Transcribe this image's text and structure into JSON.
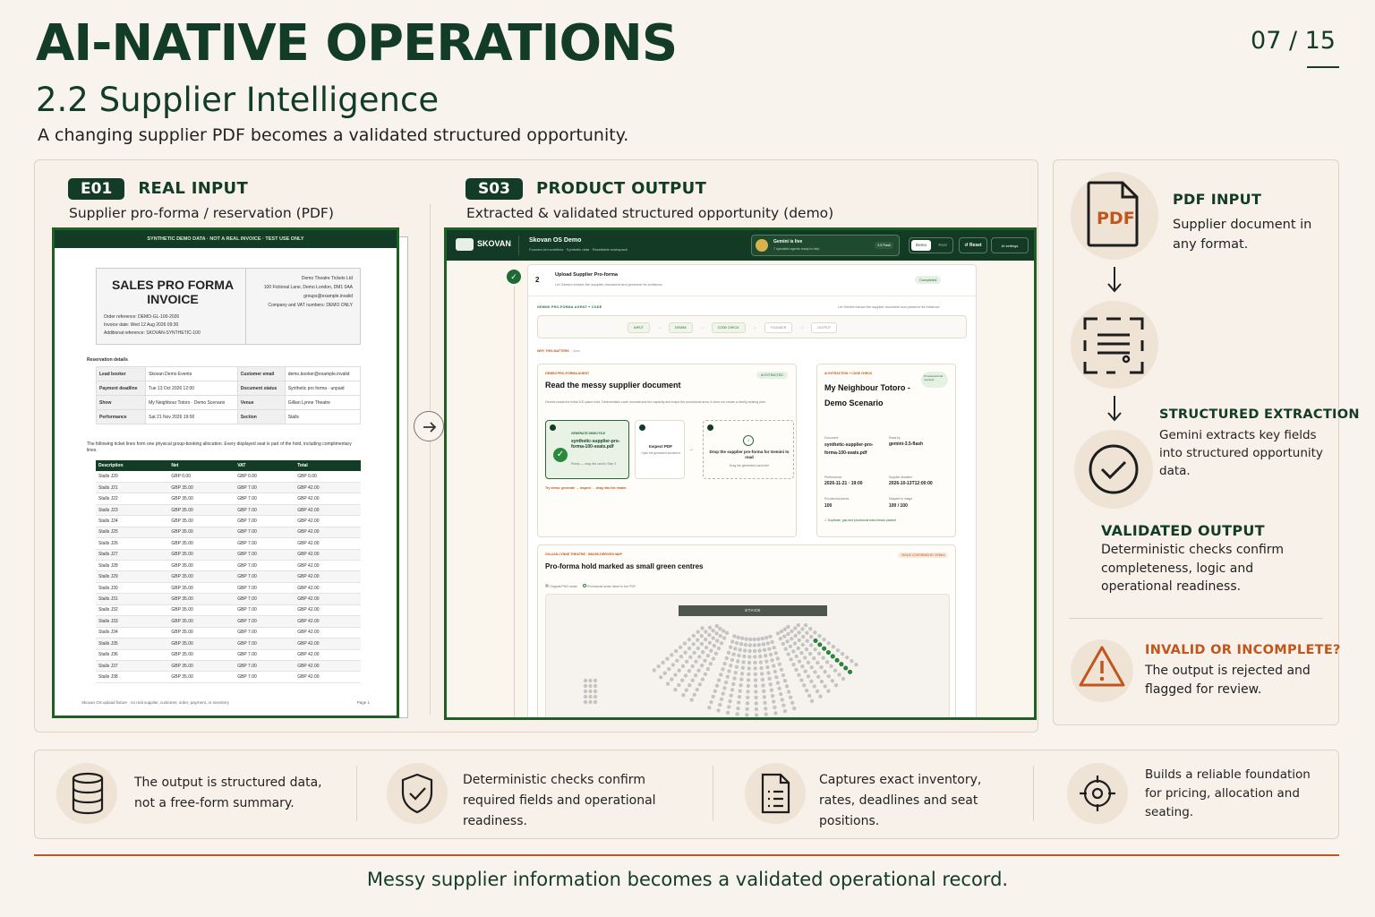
{
  "header": {
    "title": "AI-NATIVE OPERATIONS",
    "page": "07 / 15",
    "subtitle": "2.2 Supplier Intelligence",
    "tagline": "A changing supplier PDF becomes a validated structured opportunity."
  },
  "input": {
    "tag": "E01",
    "title": "REAL INPUT",
    "subtitle": "Supplier pro-forma / reservation (PDF)"
  },
  "output": {
    "tag": "S03",
    "title": "PRODUCT OUTPUT",
    "subtitle": "Extracted & validated structured opportunity (demo)"
  },
  "invoice": {
    "banner": "SYNTHETIC DEMO DATA · NOT A REAL INVOICE · TEST USE ONLY",
    "heading": "SALES PRO FORMA INVOICE",
    "order_ref": "Order reference: DEMO-GL-100-2026",
    "invoice_date": "Invoice date: Wed 12 Aug 2026 09:30",
    "additional_ref": "Additional reference: SKOVAN-SYNTHETIC-100",
    "company": "Demo Theatre Tickets Ltd",
    "address": "100 Fictional Lane, Demo London, DM1 0AA",
    "email": "groups@example.invalid",
    "vat": "Company and VAT numbers: DEMO ONLY",
    "reservation_label": "Reservation details",
    "reservation": [
      [
        "Lead booker",
        "Skovan Demo Events",
        "Customer email",
        "demo.booker@example.invalid"
      ],
      [
        "Payment deadline",
        "Tue 13 Oct 2026 12:00",
        "Document status",
        "Synthetic pro forma · unpaid"
      ],
      [
        "Show",
        "My Neighbour Totoro · Demo Scenario",
        "Venue",
        "Gillian Lynne Theatre"
      ],
      [
        "Performance",
        "Sat 21 Nov 2026 19:00",
        "Section",
        "Stalls"
      ]
    ],
    "note": "The following ticket lines form one physical group-booking allocation. Every displayed seat is part of the hold, including complimentary lines.",
    "columns": [
      "Description",
      "Net",
      "VAT",
      "Total"
    ],
    "lines": [
      [
        "Stalls J20",
        "GBP 0.00",
        "GBP 0.00",
        "GBP 0.00"
      ],
      [
        "Stalls J21",
        "GBP 35.00",
        "GBP 7.00",
        "GBP 42.00"
      ],
      [
        "Stalls J22",
        "GBP 35.00",
        "GBP 7.00",
        "GBP 42.00"
      ],
      [
        "Stalls J23",
        "GBP 35.00",
        "GBP 7.00",
        "GBP 42.00"
      ],
      [
        "Stalls J24",
        "GBP 35.00",
        "GBP 7.00",
        "GBP 42.00"
      ],
      [
        "Stalls J25",
        "GBP 35.00",
        "GBP 7.00",
        "GBP 42.00"
      ],
      [
        "Stalls J26",
        "GBP 35.00",
        "GBP 7.00",
        "GBP 42.00"
      ],
      [
        "Stalls J27",
        "GBP 35.00",
        "GBP 7.00",
        "GBP 42.00"
      ],
      [
        "Stalls J28",
        "GBP 35.00",
        "GBP 7.00",
        "GBP 42.00"
      ],
      [
        "Stalls J29",
        "GBP 35.00",
        "GBP 7.00",
        "GBP 42.00"
      ],
      [
        "Stalls J30",
        "GBP 35.00",
        "GBP 7.00",
        "GBP 42.00"
      ],
      [
        "Stalls J31",
        "GBP 35.00",
        "GBP 7.00",
        "GBP 42.00"
      ],
      [
        "Stalls J32",
        "GBP 35.00",
        "GBP 7.00",
        "GBP 42.00"
      ],
      [
        "Stalls J33",
        "GBP 35.00",
        "GBP 7.00",
        "GBP 42.00"
      ],
      [
        "Stalls J34",
        "GBP 35.00",
        "GBP 7.00",
        "GBP 42.00"
      ],
      [
        "Stalls J35",
        "GBP 35.00",
        "GBP 7.00",
        "GBP 42.00"
      ],
      [
        "Stalls J36",
        "GBP 35.00",
        "GBP 7.00",
        "GBP 42.00"
      ],
      [
        "Stalls J37",
        "GBP 35.00",
        "GBP 7.00",
        "GBP 42.00"
      ],
      [
        "Stalls J38",
        "GBP 35.00",
        "GBP 7.00",
        "GBP 42.00"
      ]
    ],
    "footer_left": "Skovan OS upload fixture · no real supplier, customer, order, payment, or inventory",
    "footer_right": "Page 1"
  },
  "app": {
    "brand": "SKOVAN",
    "product": "Skovan OS Demo",
    "product_sub": "Founder-led workflow · Synthetic data · Resettable workspace",
    "gemini_title": "Gemini is live",
    "gemini_sub": "7 specialist agents ready to help",
    "gemini_model": "3.5 Flash",
    "mode_demo": "Demo",
    "mode_real": "Real",
    "reset": "↺ Reset",
    "settings": "AI settings",
    "step_num": "2",
    "step_title": "Upload Supplier Pro-forma",
    "step_desc": "Let Gemini extract the supplier document and preserve its evidence",
    "step_badge": "Completed",
    "agent_label": "GEMINI PRO-FORMA AGENT + CODE",
    "agent_desc": "Let Gemini extract the supplier document and preserve its evidence",
    "pipeline": [
      "INPUT",
      "GEMINI",
      "CODE CHECK",
      "FOUNDER",
      "OUTPUT"
    ],
    "why": "WHY THIS MATTERS",
    "why_open": "Open",
    "read_label": "GEMINI PRO-FORMA AGENT",
    "read_badge": "AI EXTRACTED",
    "read_title": "Read the messy supplier document",
    "read_desc": "Gemini reads the initial 100-place hold. Deterministic code reconstructs the capacity and maps the provisional area; it does not create a family seating plan.",
    "gen_label": "GENERATE DEMO FILE",
    "gen_file": "synthetic-supplier-pro-forma-100-seats.pdf",
    "gen_status": "Ready — drag this card to Step 3",
    "inspect_title": "Inspect PDF",
    "inspect_desc": "Open the generated document",
    "drop_title": "Drop the supplier pro-forma for Gemini to read",
    "drop_desc": "Drag the generated card here",
    "try_demo": "Try demo: generate → inspect → drag into the reader.",
    "ext_label": "AI EXTRACTION + CODE CHECK",
    "ext_badge": "Provisional hold resolved",
    "ext_show": "My Neighbour Totoro - Demo Scenario",
    "doc_label": "Document",
    "doc_value": "synthetic-supplier-pro-forma-100-seats.pdf",
    "readby_label": "Read by",
    "readby_value": "gemini-3.5-flash",
    "perf_label": "Performance",
    "perf_value": "2026-11-21 · 19:00",
    "deadline_label": "Supplier deadline",
    "deadline_value": "2026-10-13T12:00:00",
    "places_label": "Provisional places",
    "places_value": "100",
    "mapped_label": "Mapped to image",
    "mapped_value": "100 / 100",
    "checks": "✓ Duplicate, gap and provisional total checks passed",
    "map_label": "GILLIAN LYNNE THEATRE · IMAGE-DERIVED MAP",
    "map_badge": "VENUE CONFIRMED BY GEMINI",
    "map_title": "Pro-forma hold marked as small green centres",
    "legend_a": "Original PNG seats",
    "legend_b": "Provisional seats listed in the PDF",
    "stage": "STAGE"
  },
  "right": {
    "pdf_label": "PDF",
    "pdf_title": "PDF INPUT",
    "pdf_body": "Supplier document in any format.",
    "extract_title": "STRUCTURED EXTRACTION",
    "extract_body": "Gemini extracts key fields into structured opportunity data.",
    "valid_title": "VALIDATED OUTPUT",
    "valid_body": "Deterministic checks confirm completeness, logic and operational readiness.",
    "invalid_title": "INVALID OR INCOMPLETE?",
    "invalid_body": "The output is rejected and flagged for review."
  },
  "strip": [
    {
      "icon": "database-icon",
      "text": "The output is structured data, not a free-form summary."
    },
    {
      "icon": "shield-check-icon",
      "text": "Deterministic checks confirm required fields and operational readiness."
    },
    {
      "icon": "document-list-icon",
      "text": "Captures exact inventory, rates, deadlines and seat positions."
    },
    {
      "icon": "target-icon",
      "text": "Builds a reliable foundation for pricing, allocation and seating."
    }
  ],
  "footer": "Messy supplier information becomes a validated operational record.",
  "colors": {
    "brand_green": "#123c25",
    "accent_orange": "#c0561c",
    "background": "#f8f3ec"
  }
}
